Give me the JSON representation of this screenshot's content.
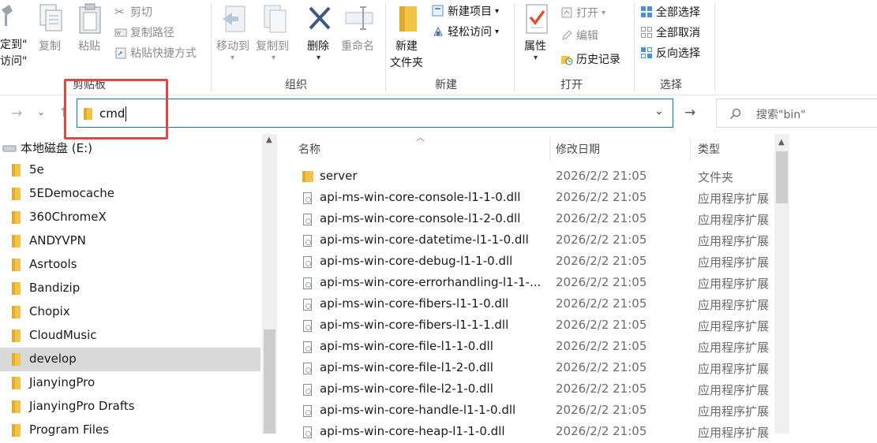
{
  "ribbon": {
    "pin_partial_line1": "定到\"",
    "pin_partial_line2": "访问\"",
    "copy": "复制",
    "paste": "粘贴",
    "cut": "剪切",
    "copy_path": "复制路径",
    "paste_shortcut": "粘贴快捷方式",
    "move_to": "移动到",
    "copy_to": "复制到",
    "delete": "删除",
    "rename": "重命名",
    "new_folder_line1": "新建",
    "new_folder_line2": "文件夹",
    "new_item": "新建项目",
    "easy_access": "轻松访问",
    "properties": "属性",
    "open": "打开",
    "edit": "编辑",
    "history": "历史记录",
    "select_all": "全部选择",
    "select_none": "全部取消",
    "invert_selection": "反向选择",
    "groups": {
      "clipboard": "剪贴板",
      "organize": "组织",
      "new": "新建",
      "open": "打开",
      "select": "选择"
    }
  },
  "address": {
    "value": "cmd",
    "search_placeholder": "搜索\"bin\""
  },
  "nav": {
    "drive": "本地磁盘 (E:)",
    "items": [
      "5e",
      "5EDemocache",
      "360ChromeX",
      "ANDYVPN",
      "Asrtools",
      "Bandizip",
      "Chopix",
      "CloudMusic",
      "develop",
      "JianyingPro",
      "JianyingPro Drafts",
      "Program Files"
    ],
    "selected_index": 8
  },
  "columns": {
    "name": "名称",
    "date": "修改日期",
    "type": "类型"
  },
  "files": [
    {
      "name": "server",
      "date": "2026/2/2 21:05",
      "type": "文件夹",
      "kind": "folder"
    },
    {
      "name": "api-ms-win-core-console-l1-1-0.dll",
      "date": "2026/2/2 21:05",
      "type": "应用程序扩展",
      "kind": "file"
    },
    {
      "name": "api-ms-win-core-console-l1-2-0.dll",
      "date": "2026/2/2 21:05",
      "type": "应用程序扩展",
      "kind": "file"
    },
    {
      "name": "api-ms-win-core-datetime-l1-1-0.dll",
      "date": "2026/2/2 21:05",
      "type": "应用程序扩展",
      "kind": "file"
    },
    {
      "name": "api-ms-win-core-debug-l1-1-0.dll",
      "date": "2026/2/2 21:05",
      "type": "应用程序扩展",
      "kind": "file"
    },
    {
      "name": "api-ms-win-core-errorhandling-l1-1-...",
      "date": "2026/2/2 21:05",
      "type": "应用程序扩展",
      "kind": "file"
    },
    {
      "name": "api-ms-win-core-fibers-l1-1-0.dll",
      "date": "2026/2/2 21:05",
      "type": "应用程序扩展",
      "kind": "file"
    },
    {
      "name": "api-ms-win-core-fibers-l1-1-1.dll",
      "date": "2026/2/2 21:05",
      "type": "应用程序扩展",
      "kind": "file"
    },
    {
      "name": "api-ms-win-core-file-l1-1-0.dll",
      "date": "2026/2/2 21:05",
      "type": "应用程序扩展",
      "kind": "file"
    },
    {
      "name": "api-ms-win-core-file-l1-2-0.dll",
      "date": "2026/2/2 21:05",
      "type": "应用程序扩展",
      "kind": "file"
    },
    {
      "name": "api-ms-win-core-file-l2-1-0.dll",
      "date": "2026/2/2 21:05",
      "type": "应用程序扩展",
      "kind": "file"
    },
    {
      "name": "api-ms-win-core-handle-l1-1-0.dll",
      "date": "2026/2/2 21:05",
      "type": "应用程序扩展",
      "kind": "file"
    },
    {
      "name": "api-ms-win-core-heap-l1-1-0.dll",
      "date": "2026/2/2 21:05",
      "type": "应用程序扩展",
      "kind": "file"
    }
  ],
  "colors": {
    "accent": "#0078d4",
    "highlight_box": "#e04848",
    "folder": "#f3c348"
  }
}
